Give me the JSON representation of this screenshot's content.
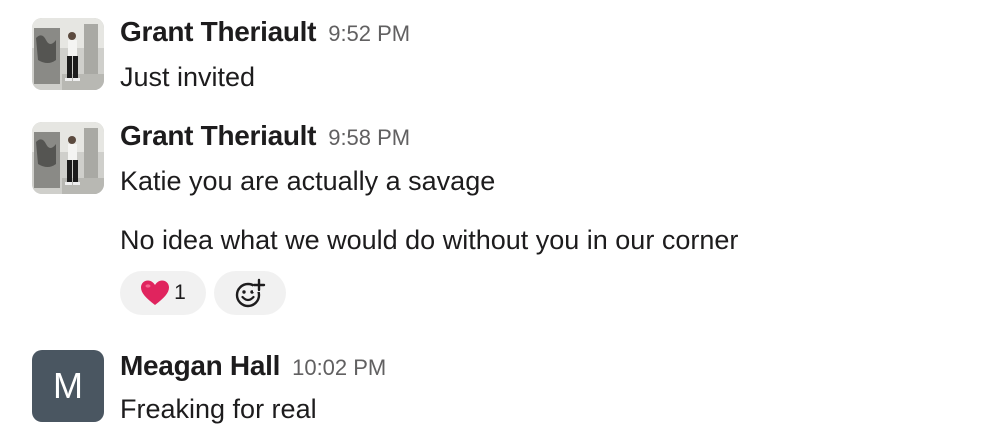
{
  "messages": [
    {
      "author": "Grant Theriault",
      "time": "9:52 PM",
      "avatar": "photo-avatar",
      "lines": [
        "Just invited"
      ]
    },
    {
      "author": "Grant Theriault",
      "time": "9:58 PM",
      "avatar": "photo-avatar",
      "lines": [
        "Katie you are actually a savage",
        "No idea what we would do without you in our corner"
      ],
      "reactions": [
        {
          "emoji": "heart",
          "count": "1"
        }
      ],
      "add_reaction_icon": "add-reaction-icon"
    },
    {
      "author": "Meagan Hall",
      "time": "10:02 PM",
      "avatar_initial": "M",
      "avatar_color": "#4a5661",
      "lines": [
        "Freaking for real"
      ]
    }
  ],
  "colors": {
    "text": "#1d1c1d",
    "timestamp": "#616061",
    "reaction_bg": "#f1f1f1",
    "heart": "#e0245e"
  }
}
